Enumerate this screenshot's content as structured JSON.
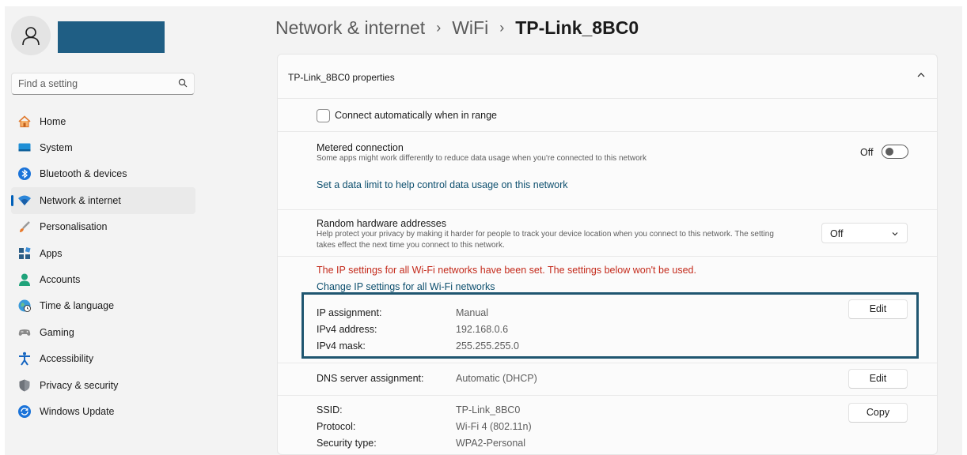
{
  "sidebar": {
    "search_placeholder": "Find a setting",
    "items": [
      {
        "label": "Home",
        "icon": "home-icon"
      },
      {
        "label": "System",
        "icon": "system-icon"
      },
      {
        "label": "Bluetooth & devices",
        "icon": "bluetooth-icon"
      },
      {
        "label": "Network & internet",
        "icon": "wifi-icon",
        "active": true
      },
      {
        "label": "Personalisation",
        "icon": "brush-icon"
      },
      {
        "label": "Apps",
        "icon": "apps-icon"
      },
      {
        "label": "Accounts",
        "icon": "accounts-icon"
      },
      {
        "label": "Time & language",
        "icon": "globe-clock-icon"
      },
      {
        "label": "Gaming",
        "icon": "gamepad-icon"
      },
      {
        "label": "Accessibility",
        "icon": "accessibility-icon"
      },
      {
        "label": "Privacy & security",
        "icon": "shield-icon"
      },
      {
        "label": "Windows Update",
        "icon": "update-icon"
      }
    ]
  },
  "breadcrumb": {
    "level1": "Network & internet",
    "level2": "WiFi",
    "current": "TP-Link_8BC0"
  },
  "card": {
    "title": "TP-Link_8BC0 properties",
    "auto_connect_label": "Connect automatically when in range",
    "metered": {
      "title": "Metered connection",
      "description": "Some apps might work differently to reduce data usage when you're connected to this network",
      "toggle_state": "Off",
      "data_limit_link": "Set a data limit to help control data usage on this network"
    },
    "random_hw": {
      "title": "Random hardware addresses",
      "description_line1": "Help protect your privacy by making it harder for people to track your device location when you connect to this network. The setting",
      "description_line2": "takes effect the next time you connect to this network.",
      "selected": "Off"
    },
    "ip_warning": "The IP settings for all Wi-Fi networks have been set. The settings below won't be used.",
    "change_ip_link": "Change IP settings for all Wi-Fi networks",
    "ip": {
      "assignment_label": "IP assignment:",
      "assignment_value": "Manual",
      "ipv4_label": "IPv4 address:",
      "ipv4_value": "192.168.0.6",
      "mask_label": "IPv4 mask:",
      "mask_value": "255.255.255.0",
      "edit_label": "Edit"
    },
    "dns": {
      "label": "DNS server assignment:",
      "value": "Automatic (DHCP)",
      "edit_label": "Edit"
    },
    "props": {
      "ssid_label": "SSID:",
      "ssid_value": "TP-Link_8BC0",
      "protocol_label": "Protocol:",
      "protocol_value": "Wi-Fi 4 (802.11n)",
      "security_label": "Security type:",
      "security_value": "WPA2-Personal",
      "copy_label": "Copy"
    }
  },
  "colors": {
    "accent": "#005fb8",
    "link": "#0d4f6e",
    "warning": "#c42b1c",
    "highlight": "#1f5670"
  }
}
